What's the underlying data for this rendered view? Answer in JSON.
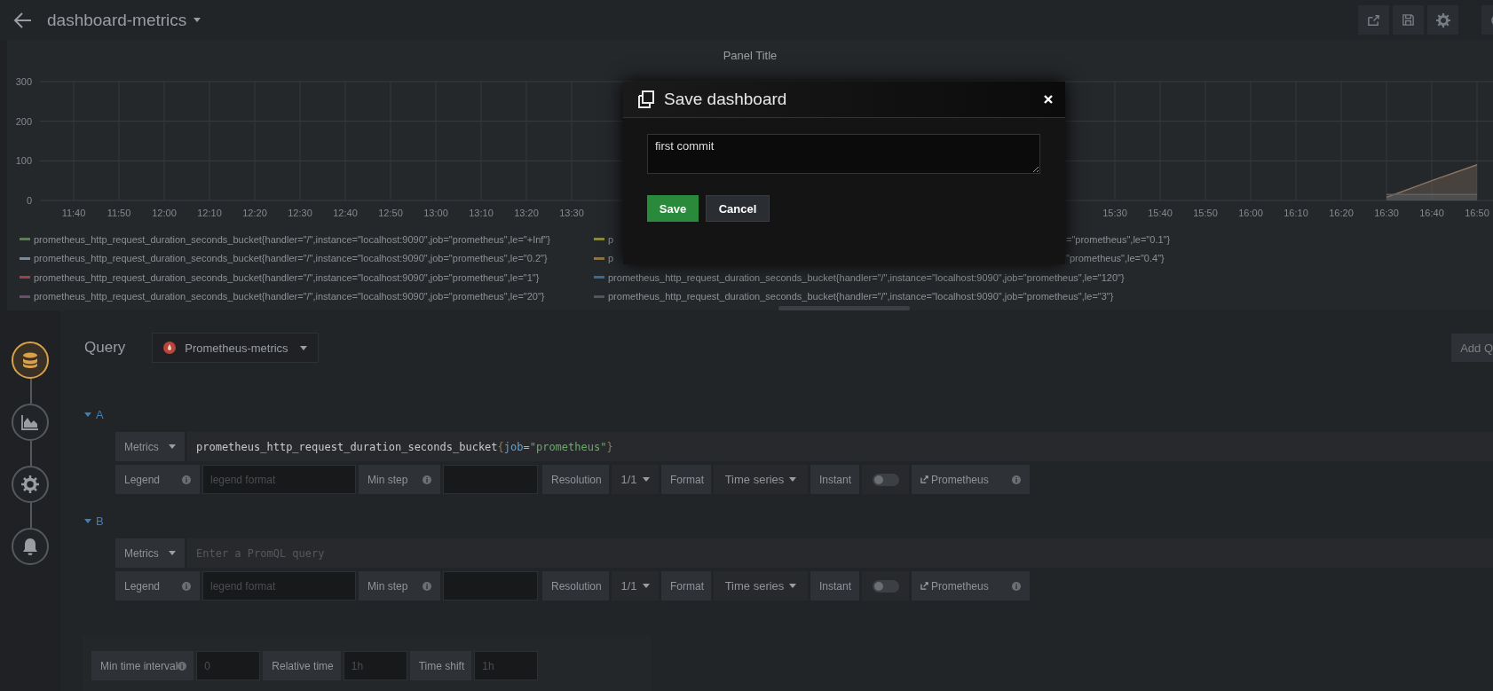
{
  "header": {
    "title": "dashboard-metrics"
  },
  "panel": {
    "title": "Panel Title",
    "chart_data": {
      "type": "area",
      "grid": true,
      "ylim": [
        0,
        300
      ],
      "yticks": [
        0,
        100,
        200,
        300
      ],
      "categories": [
        "11:40",
        "11:50",
        "12:00",
        "12:10",
        "12:20",
        "12:30",
        "12:40",
        "12:50",
        "13:00",
        "13:10",
        "13:20",
        "13:30",
        null,
        null,
        null,
        null,
        null,
        null,
        null,
        null,
        null,
        null,
        null,
        "15:30",
        "15:40",
        "15:50",
        "16:00",
        "16:10",
        "16:20",
        "16:30",
        "16:40",
        "16:50"
      ],
      "series": [
        {
          "color": "#8a7464",
          "values": [
            null,
            null,
            null,
            null,
            null,
            null,
            null,
            null,
            null,
            null,
            null,
            null,
            null,
            null,
            null,
            null,
            null,
            null,
            null,
            null,
            null,
            null,
            null,
            null,
            null,
            null,
            null,
            null,
            null,
            8,
            50,
            90
          ]
        },
        {
          "color": "#5c6166",
          "values": [
            null,
            null,
            null,
            null,
            null,
            null,
            null,
            null,
            null,
            null,
            null,
            null,
            null,
            null,
            null,
            null,
            null,
            null,
            null,
            null,
            null,
            null,
            null,
            null,
            null,
            null,
            null,
            null,
            null,
            15,
            15,
            15
          ]
        }
      ]
    },
    "legend": [
      [
        {
          "text": "prometheus_http_request_duration_seconds_bucket{handler=\"/\",instance=\"localhost:9090\",job=\"prometheus\",le=\"+Inf\"}",
          "color": "#5f7a5c"
        },
        {
          "text": "p",
          "color": "#8a8a3e"
        },
        {
          "text": "=\"prometheus\",le=\"0.1\"}"
        }
      ],
      [
        {
          "text": "prometheus_http_request_duration_seconds_bucket{handler=\"/\",instance=\"localhost:9090\",job=\"prometheus\",le=\"0.2\"}",
          "color": "#7c8898"
        },
        {
          "text": "p",
          "color": "#8a7448"
        },
        {
          "text": "\"prometheus\",le=\"0.4\"}"
        }
      ],
      [
        {
          "text": "prometheus_http_request_duration_seconds_bucket{handler=\"/\",instance=\"localhost:9090\",job=\"prometheus\",le=\"1\"}",
          "color": "#9a4444"
        },
        {
          "text": "prometheus_http_request_duration_seconds_bucket{handler=\"/\",instance=\"localhost:9090\",job=\"prometheus\",le=\"120\"}",
          "color": "#3a6a94"
        }
      ],
      [
        {
          "text": "prometheus_http_request_duration_seconds_bucket{handler=\"/\",instance=\"localhost:9090\",job=\"prometheus\",le=\"20\"}",
          "color": "#6a4f6a"
        },
        {
          "text": "prometheus_http_request_duration_seconds_bucket{handler=\"/\",instance=\"localhost:9090\",job=\"prometheus\",le=\"3\"}",
          "color": "#50565e"
        }
      ]
    ]
  },
  "editor": {
    "title": "Query",
    "datasource": "Prometheus-metrics",
    "add_button": "Add Q",
    "steps": [
      {
        "kind": "queries",
        "selected": true
      },
      {
        "kind": "visualization",
        "selected": false
      },
      {
        "kind": "general",
        "selected": false
      },
      {
        "kind": "alert",
        "selected": false
      }
    ],
    "queries": [
      {
        "letter": "A",
        "metrics_label": "Metrics",
        "query_tokens": [
          {
            "text": "prometheus_http_request_duration_seconds_bucket",
            "kind": "metric"
          },
          {
            "text": "{",
            "kind": "brace"
          },
          {
            "text": "job",
            "kind": "label"
          },
          {
            "text": "=",
            "kind": "op"
          },
          {
            "text": "\"prometheus\"",
            "kind": "string"
          },
          {
            "text": "}",
            "kind": "brace"
          }
        ],
        "legend_label": "Legend",
        "legend_placeholder": "legend format",
        "min_step_label": "Min step",
        "resolution_label": "Resolution",
        "resolution": "1/1",
        "format_label": "Format",
        "format": "Time series",
        "instant_label": "Instant",
        "instant_on": false,
        "link": "Prometheus"
      },
      {
        "letter": "B",
        "metrics_label": "Metrics",
        "placeholder": "Enter a PromQL query",
        "legend_label": "Legend",
        "legend_placeholder": "legend format",
        "min_step_label": "Min step",
        "resolution_label": "Resolution",
        "resolution": "1/1",
        "format_label": "Format",
        "format": "Time series",
        "instant_label": "Instant",
        "instant_on": false,
        "link": "Prometheus"
      }
    ],
    "options": [
      {
        "label": "Min time interval",
        "info": true,
        "placeholder": "0"
      },
      {
        "label": "Relative time",
        "info": false,
        "placeholder": "1h"
      },
      {
        "label": "Time shift",
        "info": false,
        "placeholder": "1h"
      }
    ]
  },
  "modal": {
    "title": "Save dashboard",
    "message": "first commit",
    "buttons": [
      {
        "label": "Save",
        "kind": "primary"
      },
      {
        "label": "Cancel",
        "kind": "secondary"
      }
    ]
  }
}
